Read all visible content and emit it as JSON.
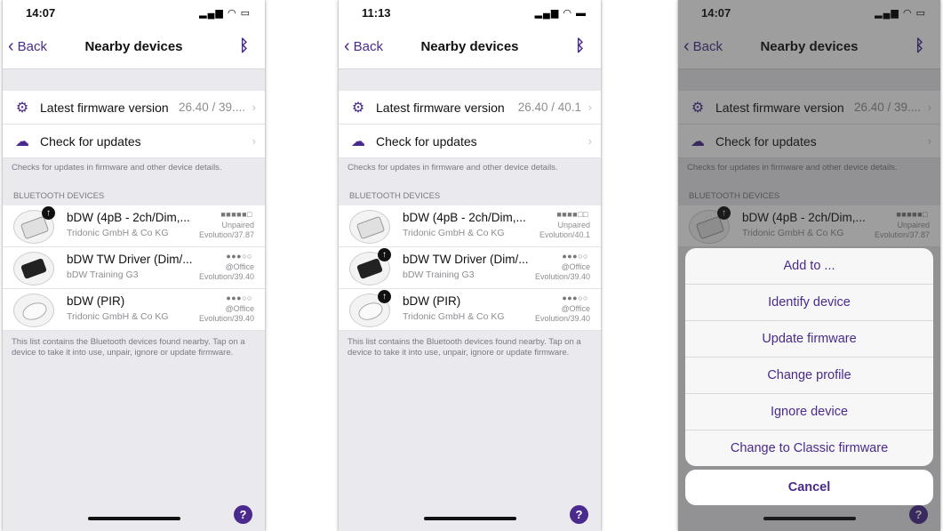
{
  "screens": [
    {
      "time": "14:07",
      "nav": {
        "back": "Back",
        "title": "Nearby devices"
      },
      "firmware": {
        "label": "Latest firmware version",
        "value": "26.40 / 39...."
      },
      "updates": {
        "label": "Check for updates"
      },
      "updates_note": "Checks for updates in firmware and other device details.",
      "section": "BLUETOOTH DEVICES",
      "devices": [
        {
          "name": "bDW (4pB - 2ch/Dim,...",
          "sub": "Tridonic GmbH & Co KG",
          "signal": "■■■■■□",
          "status": "Unpaired",
          "version": "Evolution/37.87",
          "type": "white",
          "update": true
        },
        {
          "name": "bDW TW Driver (Dim/...",
          "sub": "bDW Training G3",
          "signal": "●●●○○",
          "status": "@Office",
          "version": "Evolution/39.40",
          "type": "black",
          "update": false
        },
        {
          "name": "bDW (PIR)",
          "sub": "Tridonic GmbH & Co KG",
          "signal": "●●●○○",
          "status": "@Office",
          "version": "Evolution/39.40",
          "type": "round",
          "update": false
        }
      ],
      "footer": "This list contains the Bluetooth devices found nearby. Tap on a device to take it into use, unpair, ignore or update firmware."
    },
    {
      "time": "11:13",
      "nav": {
        "back": "Back",
        "title": "Nearby devices"
      },
      "firmware": {
        "label": "Latest firmware version",
        "value": "26.40 / 40.1"
      },
      "updates": {
        "label": "Check for updates"
      },
      "updates_note": "Checks for updates in firmware and other device details.",
      "section": "BLUETOOTH DEVICES",
      "devices": [
        {
          "name": "bDW (4pB - 2ch/Dim,...",
          "sub": "Tridonic GmbH & Co KG",
          "signal": "■■■■□□",
          "status": "Unpaired",
          "version": "Evolution/40.1",
          "type": "white",
          "update": false
        },
        {
          "name": "bDW TW Driver (Dim/...",
          "sub": "bDW Training G3",
          "signal": "●●●○○",
          "status": "@Office",
          "version": "Evolution/39.40",
          "type": "black",
          "update": true
        },
        {
          "name": "bDW (PIR)",
          "sub": "Tridonic GmbH & Co KG",
          "signal": "●●●○○",
          "status": "@Office",
          "version": "Evolution/39.40",
          "type": "round",
          "update": true
        }
      ],
      "footer": "This list contains the Bluetooth devices found nearby. Tap on a device to take it into use, unpair, ignore or update firmware."
    },
    {
      "time": "14:07",
      "nav": {
        "back": "Back",
        "title": "Nearby devices"
      },
      "firmware": {
        "label": "Latest firmware version",
        "value": "26.40 / 39...."
      },
      "updates": {
        "label": "Check for updates"
      },
      "updates_note": "Checks for updates in firmware and other device details.",
      "section": "BLUETOOTH DEVICES",
      "devices": [
        {
          "name": "bDW (4pB - 2ch/Dim,...",
          "sub": "Tridonic GmbH & Co KG",
          "signal": "■■■■■□",
          "status": "Unpaired",
          "version": "Evolution/37.87",
          "type": "white",
          "update": true
        }
      ],
      "footer": "",
      "action_sheet": {
        "items": [
          "Add to ...",
          "Identify device",
          "Update firmware",
          "Change profile",
          "Ignore device",
          "Change to Classic firmware"
        ],
        "cancel": "Cancel"
      }
    }
  ],
  "icons": {
    "back": "chevron-left-icon",
    "bluetooth": "bluetooth-icon",
    "firmware": "gears-icon",
    "updates": "cloud-icon",
    "help": "help-icon",
    "update_badge": "arrow-up-icon"
  },
  "colors": {
    "accent": "#4a2a8c",
    "background": "#e9e9ee"
  }
}
